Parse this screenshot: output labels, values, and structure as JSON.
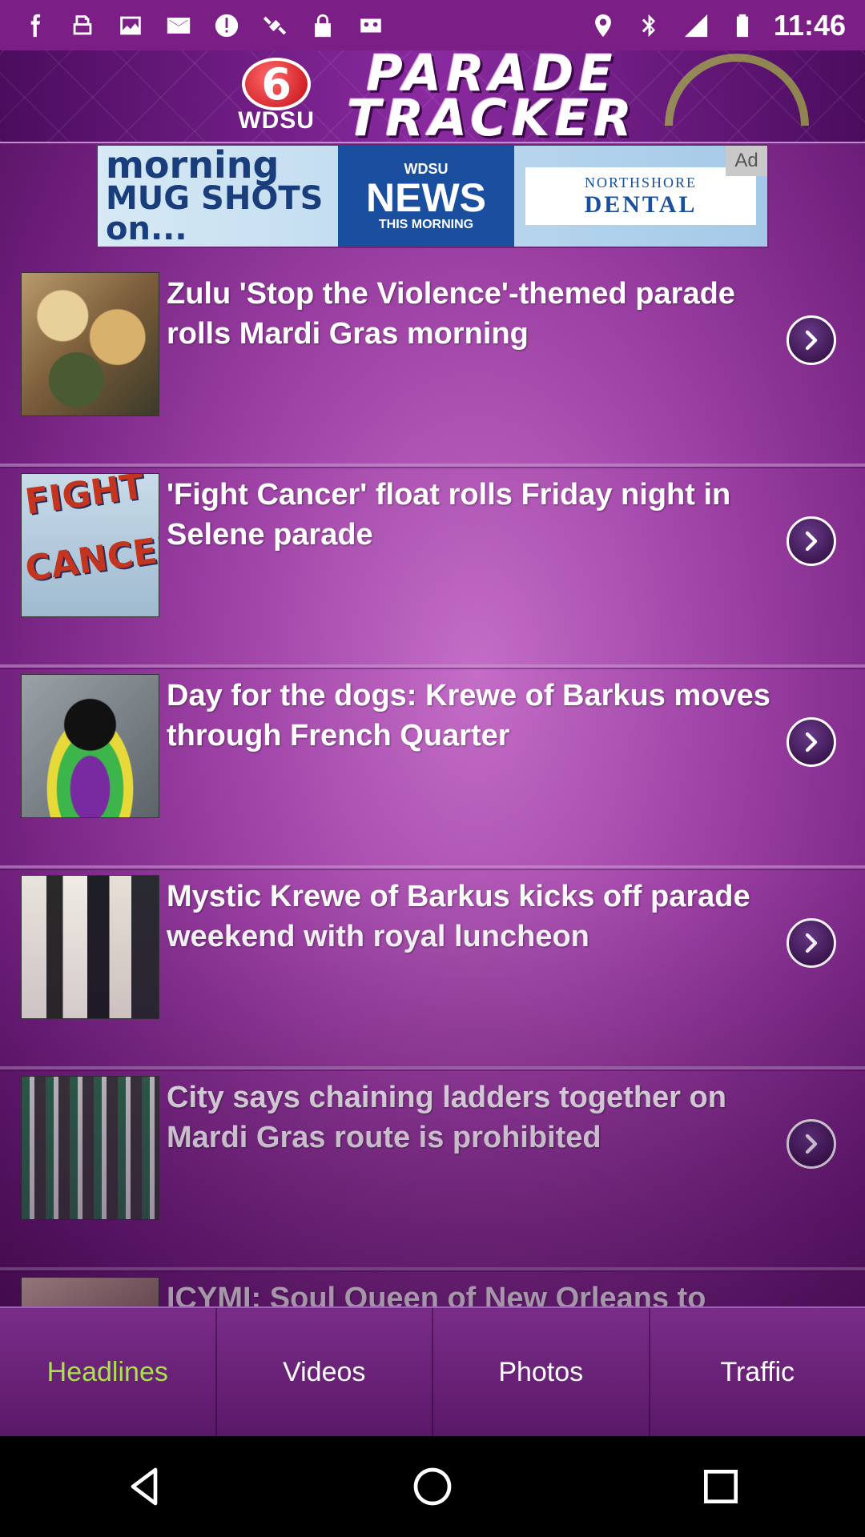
{
  "status_bar": {
    "time": "11:46",
    "left_icons": [
      "facebook-icon",
      "fax-icon",
      "image-icon",
      "mail-icon",
      "block-icon",
      "satellite-icon",
      "lock-icon",
      "cassette-icon"
    ],
    "right_icons": [
      "location-icon",
      "bluetooth-icon",
      "signal-icon",
      "battery-icon"
    ]
  },
  "header": {
    "channel_number": "6",
    "call_sign": "WDSU",
    "title_line1": "PARADE",
    "title_line2": "TRACKER"
  },
  "ad": {
    "badge": "Ad",
    "mug_line1": "morning",
    "mug_line2": "MUG SHOTS on...",
    "news_call_sign": "WDSU",
    "news_word": "NEWS",
    "news_tagline": "THIS MORNING",
    "sponsor_line1": "NORTHSHORE",
    "sponsor_line2": "DENTAL"
  },
  "headlines": [
    {
      "title": "Zulu 'Stop the Violence'-themed parade rolls Mardi Gras morning",
      "thumb": "zulu"
    },
    {
      "title": "'Fight Cancer' float rolls Friday night in Selene parade",
      "thumb": "fight"
    },
    {
      "title": "Day for the dogs: Krewe of Barkus moves through French Quarter",
      "thumb": "dog"
    },
    {
      "title": "Mystic Krewe of Barkus kicks off parade weekend with royal luncheon",
      "thumb": "krewe"
    },
    {
      "title": "City says chaining ladders together on Mardi Gras route is prohibited",
      "thumb": "ladders"
    },
    {
      "title": "ICYMI: Soul Queen of New Orleans to",
      "thumb": "soul"
    }
  ],
  "fight_thumb_text": {
    "line1": "FIGHT",
    "line2": "CANCER"
  },
  "tabs": {
    "headlines": "Headlines",
    "videos": "Videos",
    "photos": "Photos",
    "traffic": "Traffic",
    "active": "Headlines"
  },
  "colors": {
    "accent_active_tab": "#a9e24a",
    "app_purple": "#9b3fa3",
    "status_bar": "#7b1f86"
  }
}
